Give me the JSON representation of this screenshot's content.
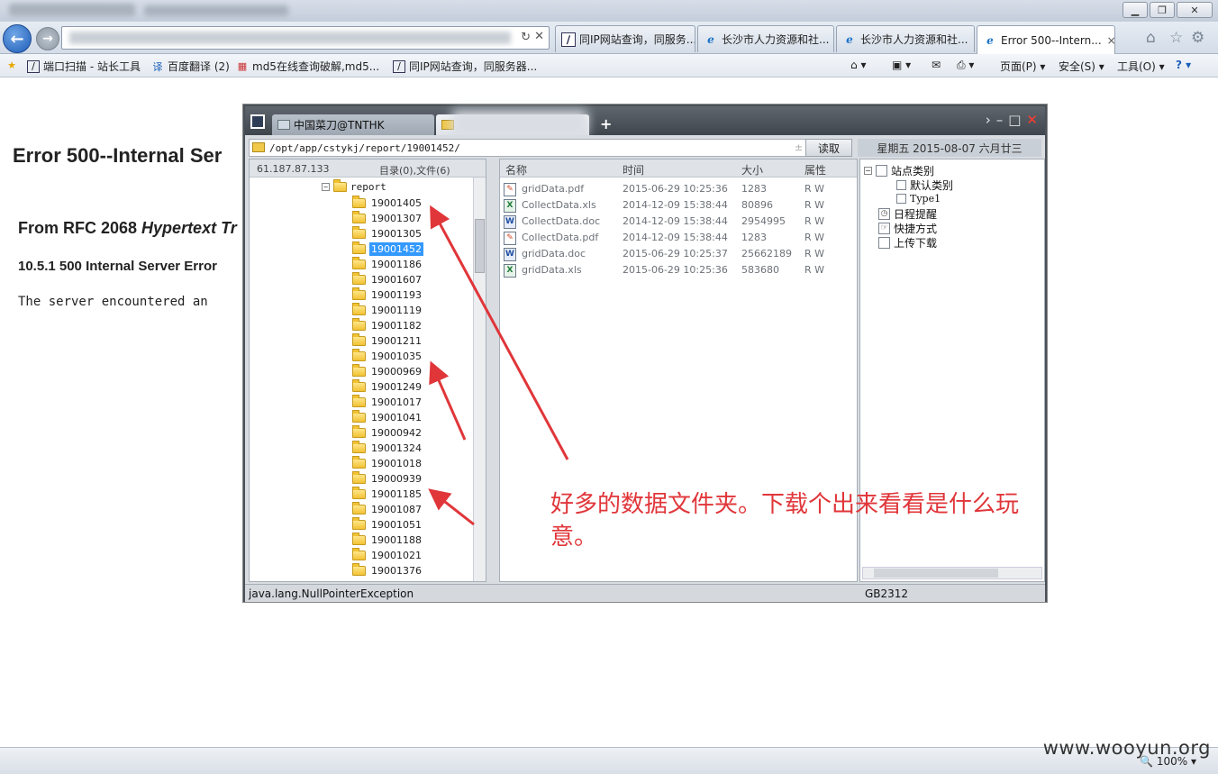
{
  "browser": {
    "tabs": [
      {
        "label": "同IP网站查询，同服务...",
        "icon": "site-favicon"
      },
      {
        "label": "长沙市人力资源和社...",
        "icon": "ie-icon"
      },
      {
        "label": "长沙市人力资源和社...",
        "icon": "ie-icon"
      },
      {
        "label": "Error 500--Intern...",
        "icon": "ie-icon",
        "active": true
      }
    ],
    "tab_close": "×",
    "address_refresh": "↻",
    "address_stop": "✕",
    "favorites": [
      {
        "label": "端口扫描 - 站长工具",
        "icon": "site-favicon"
      },
      {
        "label": "百度翻译 (2)",
        "icon": "translate-icon"
      },
      {
        "label": "md5在线查询破解,md5...",
        "icon": "grid-favicon"
      },
      {
        "label": "同IP网站查询，同服务器...",
        "icon": "site-favicon"
      }
    ],
    "commands": {
      "page": "页面(P) ▾",
      "safety": "安全(S) ▾",
      "tools": "工具(O) ▾",
      "help": "? ▾"
    },
    "zoom": "100%"
  },
  "page": {
    "title": "Error 500--Internal Ser",
    "rfc_heading_prefix": "From RFC 2068 ",
    "rfc_heading_italic": "Hypertext Tr",
    "sub_heading": "10.5.1 500 Internal Server Error",
    "body": "The server encountered an"
  },
  "chopper": {
    "tab1_title": "中国菜刀@TNTHK",
    "new_tab": "+",
    "path": "/opt/app/cstykj/report/19001452/",
    "read_button": "读取",
    "date": "星期五 2015-08-07 六月廿三",
    "ip": "61.187.87.133",
    "dir_count": "目录(0),文件(6)",
    "tree_root": "report",
    "folders": [
      "19001405",
      "19001307",
      "19001305",
      "19001452",
      "19001186",
      "19001607",
      "19001193",
      "19001119",
      "19001182",
      "19001211",
      "19001035",
      "19000969",
      "19001249",
      "19001017",
      "19001041",
      "19000942",
      "19001324",
      "19001018",
      "19000939",
      "19001185",
      "19001087",
      "19001051",
      "19001188",
      "19001021",
      "19001376"
    ],
    "selected_folder": "19001452",
    "columns": {
      "name": "名称",
      "time": "时间",
      "size": "大小",
      "attr": "属性"
    },
    "files": [
      {
        "name": "gridData.pdf",
        "time": "2015-06-29 10:25:36",
        "size": "1283",
        "attr": "R W",
        "type": "pdf"
      },
      {
        "name": "CollectData.xls",
        "time": "2014-12-09 15:38:44",
        "size": "80896",
        "attr": "R W",
        "type": "xls"
      },
      {
        "name": "CollectData.doc",
        "time": "2014-12-09 15:38:44",
        "size": "2954995",
        "attr": "R W",
        "type": "doc"
      },
      {
        "name": "CollectData.pdf",
        "time": "2014-12-09 15:38:44",
        "size": "1283",
        "attr": "R W",
        "type": "pdf"
      },
      {
        "name": "gridData.doc",
        "time": "2015-06-29 10:25:37",
        "size": "25662189",
        "attr": "R W",
        "type": "doc"
      },
      {
        "name": "gridData.xls",
        "time": "2015-06-29 10:25:36",
        "size": "583680",
        "attr": "R W",
        "type": "xls"
      }
    ],
    "right_tree": {
      "site_category": "站点类别",
      "default_category": "默认类别",
      "type1": "Type1",
      "schedule": "日程提醒",
      "shortcuts": "快捷方式",
      "upload_download": "上传下载"
    },
    "status_message": "java.lang.NullPointerException",
    "encoding": "GB2312"
  },
  "annotation": {
    "text": "好多的数据文件夹。下载个出来看看是什么玩意。",
    "color": "#e0363a"
  },
  "watermark": "www.wooyun.org"
}
